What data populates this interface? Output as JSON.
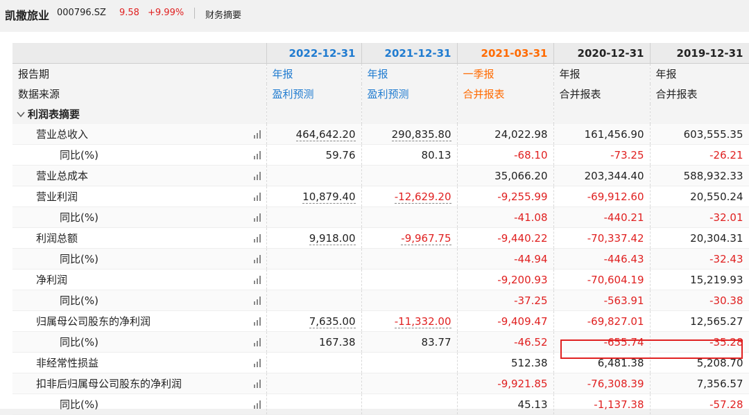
{
  "header": {
    "stock_name": "凯撒旅业",
    "stock_code": "000796.SZ",
    "price": "9.58",
    "change": "+9.99%",
    "page_title": "财务摘要"
  },
  "table": {
    "columns": [
      {
        "date": "2022-12-31",
        "report": "年报",
        "source": "盈利预测",
        "color": "blue"
      },
      {
        "date": "2021-12-31",
        "report": "年报",
        "source": "盈利预测",
        "color": "blue"
      },
      {
        "date": "2021-03-31",
        "report": "一季报",
        "source": "合并报表",
        "color": "orange"
      },
      {
        "date": "2020-12-31",
        "report": "年报",
        "source": "合并报表",
        "color": "dark"
      },
      {
        "date": "2019-12-31",
        "report": "年报",
        "source": "合并报表",
        "color": "dark"
      }
    ],
    "meta_labels": {
      "period": "报告期",
      "source": "数据来源"
    },
    "section_label": "利润表摘要",
    "rows": [
      {
        "label": "营业总收入",
        "indent": 1,
        "values": [
          "464,642.20",
          "290,835.80",
          "24,022.98",
          "161,456.90",
          "603,555.35"
        ]
      },
      {
        "label": "同比(%)",
        "indent": 2,
        "values": [
          "59.76",
          "80.13",
          "-68.10",
          "-73.25",
          "-26.21"
        ]
      },
      {
        "label": "营业总成本",
        "indent": 1,
        "values": [
          "",
          "",
          "35,066.20",
          "203,344.40",
          "588,932.33"
        ]
      },
      {
        "label": "营业利润",
        "indent": 1,
        "values": [
          "10,879.40",
          "-12,629.20",
          "-9,255.99",
          "-69,912.60",
          "20,550.24"
        ]
      },
      {
        "label": "同比(%)",
        "indent": 2,
        "values": [
          "",
          "",
          "-41.08",
          "-440.21",
          "-32.01"
        ]
      },
      {
        "label": "利润总额",
        "indent": 1,
        "values": [
          "9,918.00",
          "-9,967.75",
          "-9,440.22",
          "-70,337.42",
          "20,304.31"
        ]
      },
      {
        "label": "同比(%)",
        "indent": 2,
        "values": [
          "",
          "",
          "-44.94",
          "-446.43",
          "-32.43"
        ]
      },
      {
        "label": "净利润",
        "indent": 1,
        "values": [
          "",
          "",
          "-9,200.93",
          "-70,604.19",
          "15,219.93"
        ]
      },
      {
        "label": "同比(%)",
        "indent": 2,
        "values": [
          "",
          "",
          "-37.25",
          "-563.91",
          "-30.38"
        ]
      },
      {
        "label": "归属母公司股东的净利润",
        "indent": 1,
        "values": [
          "7,635.00",
          "-11,332.00",
          "-9,409.47",
          "-69,827.01",
          "12,565.27"
        ]
      },
      {
        "label": "同比(%)",
        "indent": 2,
        "values": [
          "167.38",
          "83.77",
          "-46.52",
          "-655.74",
          "-35.28"
        ]
      },
      {
        "label": "非经常性损益",
        "indent": 1,
        "values": [
          "",
          "",
          "512.38",
          "6,481.38",
          "5,208.70"
        ]
      },
      {
        "label": "扣非后归属母公司股东的净利润",
        "indent": 1,
        "values": [
          "",
          "",
          "-9,921.85",
          "-76,308.39",
          "7,356.57"
        ]
      },
      {
        "label": "同比(%)",
        "indent": 2,
        "values": [
          "",
          "",
          "45.13",
          "-1,137.38",
          "-57.28"
        ]
      }
    ]
  },
  "colors": {
    "blue": "#1f7bd0",
    "orange": "#ff6a00",
    "red": "#e02020",
    "dark": "#222222"
  },
  "icons": {
    "chart": "bar-chart-icon",
    "collapse": "chevron-down-icon"
  }
}
